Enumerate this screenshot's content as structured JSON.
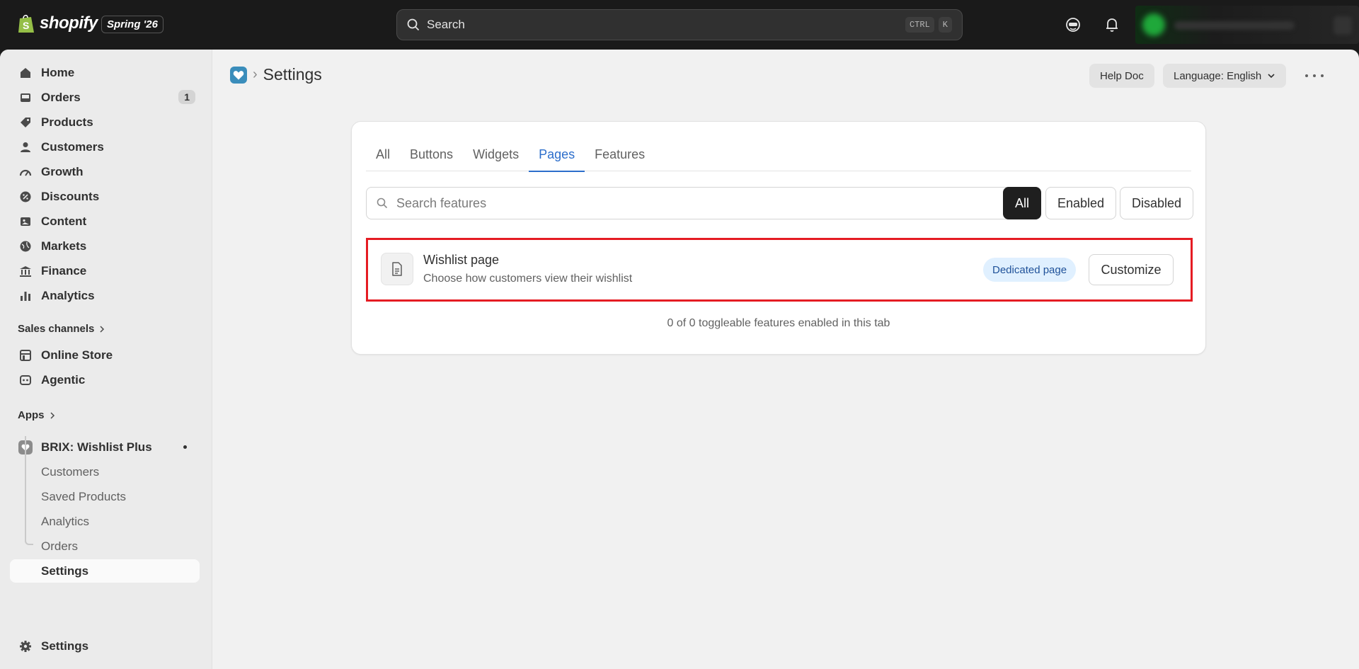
{
  "topbar": {
    "brand": "shopify",
    "edition": "Spring '26",
    "search_placeholder": "Search",
    "shortcut_keys": [
      "CTRL",
      "K"
    ]
  },
  "sidebar": {
    "main_items": [
      {
        "label": "Home",
        "icon": "home-icon"
      },
      {
        "label": "Orders",
        "icon": "orders-icon",
        "badge": "1"
      },
      {
        "label": "Products",
        "icon": "tag-icon"
      },
      {
        "label": "Customers",
        "icon": "person-icon"
      },
      {
        "label": "Growth",
        "icon": "gauge-icon"
      },
      {
        "label": "Discounts",
        "icon": "discount-icon"
      },
      {
        "label": "Content",
        "icon": "image-icon"
      },
      {
        "label": "Markets",
        "icon": "globe-icon"
      },
      {
        "label": "Finance",
        "icon": "bank-icon"
      },
      {
        "label": "Analytics",
        "icon": "bar-chart-icon"
      }
    ],
    "sales_channels_label": "Sales channels",
    "channels": [
      {
        "label": "Online Store",
        "icon": "store-icon"
      },
      {
        "label": "Agentic",
        "icon": "agent-icon"
      }
    ],
    "apps_label": "Apps",
    "app": {
      "name": "BRIX: Wishlist Plus",
      "sub_items": [
        "Customers",
        "Saved Products",
        "Analytics",
        "Orders",
        "Settings"
      ],
      "active_sub_item": "Settings"
    },
    "settings_label": "Settings"
  },
  "header": {
    "title": "Settings",
    "help_label": "Help Doc",
    "language_label": "Language: English"
  },
  "card": {
    "tabs": [
      "All",
      "Buttons",
      "Widgets",
      "Pages",
      "Features"
    ],
    "selected_tab": "Pages",
    "search_placeholder": "Search features",
    "filters": [
      "All",
      "Enabled",
      "Disabled"
    ],
    "selected_filter": "All",
    "feature": {
      "title": "Wishlist page",
      "description": "Choose how customers view their wishlist",
      "badge": "Dedicated page",
      "action": "Customize"
    },
    "summary": "0 of 0 toggleable features enabled in this tab"
  },
  "colors": {
    "accent_blue": "#2c6ecb",
    "highlight_border": "#e51c23",
    "badge_bg": "#e0f0ff",
    "topbar_bg": "#1a1a1a"
  }
}
